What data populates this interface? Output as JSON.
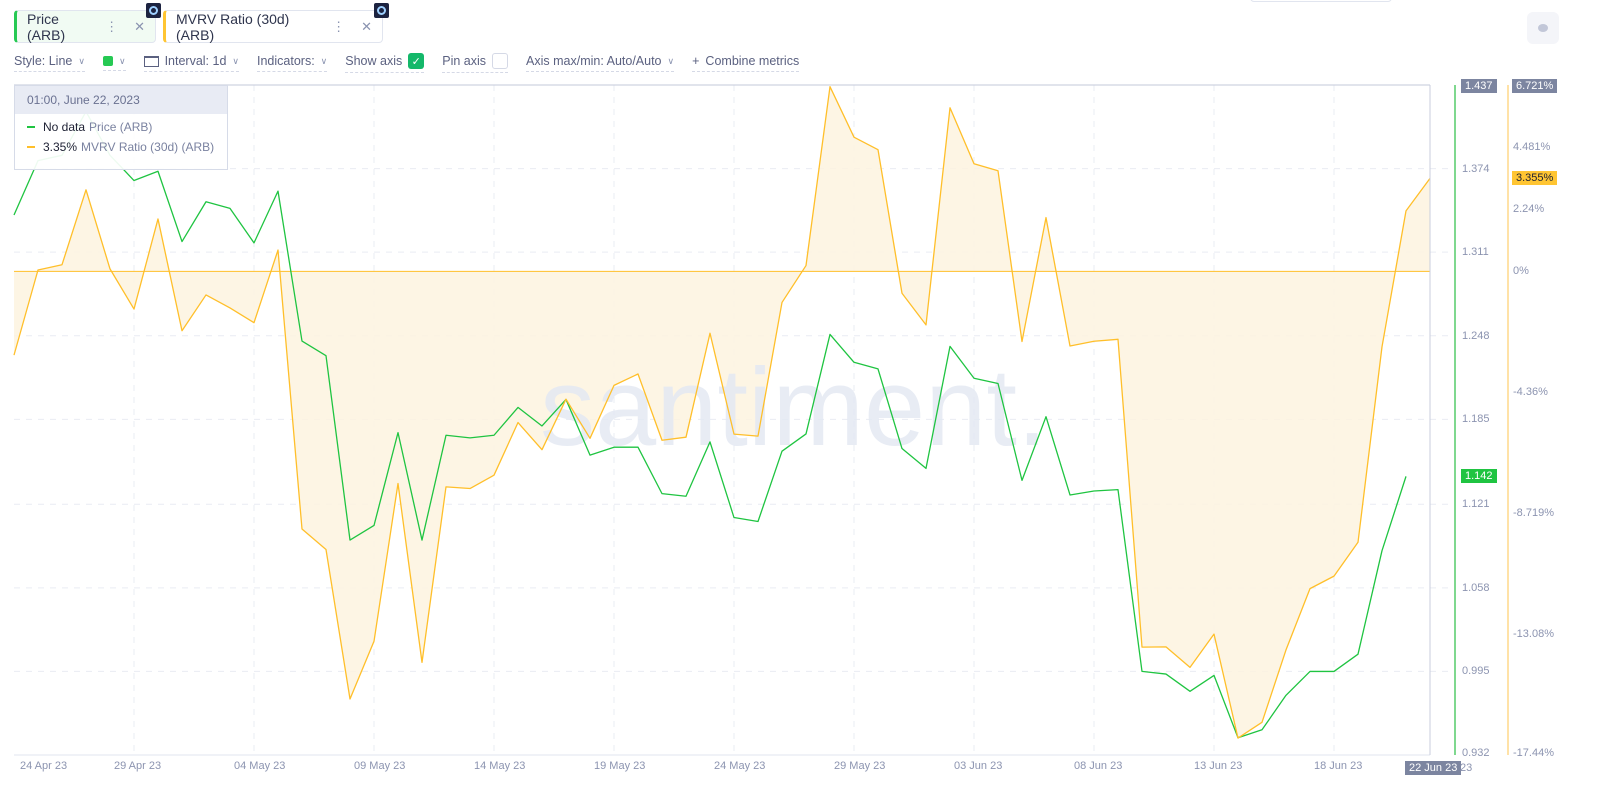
{
  "tabs": [
    {
      "label": "Price (ARB)",
      "color": "#26c953",
      "bg": "#f1fbf3"
    },
    {
      "label": "MVRV Ratio (30d) (ARB)",
      "color": "#ffc532",
      "bg": "#ffffff"
    }
  ],
  "toolbar": {
    "style": "Style: Line",
    "interval": "Interval: 1d",
    "indicators": "Indicators:",
    "show_axis": "Show axis",
    "pin_axis": "Pin axis",
    "axis_maxmin": "Axis max/min: Auto/Auto",
    "combine": "Combine metrics",
    "combine_icon": "+"
  },
  "tooltip": {
    "date": "01:00, June 22, 2023",
    "rows": [
      {
        "value": "No data",
        "label": "Price (ARB)"
      },
      {
        "value": "3.35%",
        "label": "MVRV Ratio (30d) (ARB)"
      }
    ]
  },
  "watermark": "santiment.",
  "colors": {
    "price": "#1fc441",
    "mvrv": "#ffbf2a",
    "fill": "#fdf3df",
    "axis_flag": "#7c85a0"
  },
  "chart_data": {
    "type": "line",
    "x_ticks": [
      "24 Apr 23",
      "29 Apr 23",
      "04 May 23",
      "09 May 23",
      "14 May 23",
      "19 May 23",
      "24 May 23",
      "29 May 23",
      "03 Jun 23",
      "08 Jun 23",
      "13 Jun 23",
      "18 Jun 23"
    ],
    "x_start": "24 Apr 23",
    "x_end": "22 Jun 23",
    "cursor_label": "22 Jun 23",
    "cursor_suffix": "23",
    "price_axis": {
      "ticks": [
        "1.437",
        "1.374",
        "1.311",
        "1.248",
        "1.185",
        "1.121",
        "1.058",
        "0.995",
        "0.932"
      ],
      "range": [
        0.932,
        1.437
      ],
      "current": "1.142"
    },
    "mvrv_axis": {
      "ticks": [
        {
          "v": 6.721,
          "l": "6.721%"
        },
        {
          "v": 4.481,
          "l": "4.481%"
        },
        {
          "v": 2.24,
          "l": "2.24%"
        },
        {
          "v": 0,
          "l": "0%"
        },
        {
          "v": -4.36,
          "l": "-4.36%"
        },
        {
          "v": -8.719,
          "l": "-8.719%"
        },
        {
          "v": -13.08,
          "l": "-13.08%"
        },
        {
          "v": -17.44,
          "l": "-17.44%"
        }
      ],
      "range": [
        -17.44,
        6.721
      ],
      "current": "3.355%"
    },
    "series": [
      {
        "name": "Price (ARB)",
        "values": [
          1.339,
          1.38,
          1.384,
          1.417,
          1.384,
          1.365,
          1.372,
          1.319,
          1.349,
          1.344,
          1.318,
          1.357,
          1.244,
          1.233,
          1.094,
          1.105,
          1.175,
          1.094,
          1.173,
          1.171,
          1.173,
          1.194,
          1.18,
          1.2,
          1.158,
          1.164,
          1.164,
          1.129,
          1.127,
          1.168,
          1.111,
          1.108,
          1.161,
          1.174,
          1.249,
          1.228,
          1.223,
          1.163,
          1.148,
          1.24,
          1.216,
          1.212,
          1.139,
          1.187,
          1.128,
          1.131,
          1.132,
          0.995,
          0.993,
          0.98,
          0.992,
          0.945,
          0.951,
          0.977,
          0.995,
          0.995,
          1.008,
          1.086,
          1.142
        ]
      },
      {
        "name": "MVRV Ratio (30d) (ARB)",
        "values": [
          -3.02,
          0.05,
          0.24,
          2.94,
          0.09,
          -1.36,
          1.89,
          -2.14,
          -0.85,
          -1.32,
          -1.85,
          0.77,
          -9.29,
          -10.03,
          -15.42,
          -13.34,
          -7.65,
          -14.1,
          -7.77,
          -7.83,
          -7.35,
          -5.45,
          -6.43,
          -4.61,
          -6.02,
          -4.11,
          -3.7,
          -6.09,
          -5.98,
          -2.23,
          -5.87,
          -5.94,
          -1.12,
          0.21,
          6.66,
          4.84,
          4.39,
          -0.79,
          -1.93,
          5.9,
          3.88,
          3.63,
          -2.53,
          1.94,
          -2.69,
          -2.52,
          -2.45,
          -13.55,
          -13.54,
          -14.28,
          -13.08,
          -16.83,
          -16.26,
          -13.65,
          -11.44,
          -10.99,
          -9.77,
          -2.72,
          2.18,
          3.355
        ]
      }
    ]
  }
}
